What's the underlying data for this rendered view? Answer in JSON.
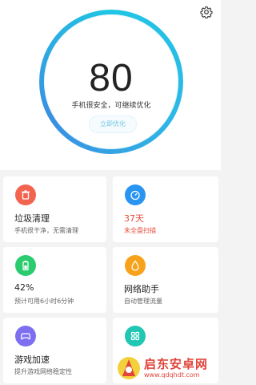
{
  "header": {
    "score": "80",
    "status_text": "手机很安全，可继续优化",
    "optimize_label": "立即优化"
  },
  "cards": [
    {
      "title": "垃圾清理",
      "subtitle": "手机很干净，无需清理",
      "icon": "trash-icon",
      "color": "#f26350"
    },
    {
      "title": "37天",
      "subtitle": "未全盘扫描",
      "icon": "stopwatch-icon",
      "color": "#2a95f0",
      "alert": true
    },
    {
      "title": "42%",
      "subtitle": "预计可用6小时6分钟",
      "icon": "battery-icon",
      "color": "#2bcb6f"
    },
    {
      "title": "网络助手",
      "subtitle": "自动管理流量",
      "icon": "droplet-icon",
      "color": "#f7a21b"
    },
    {
      "title": "游戏加速",
      "subtitle": "提升游戏网络稳定性",
      "icon": "gamepad-icon",
      "color": "#7d6ff0"
    },
    {
      "title": "",
      "subtitle": "",
      "icon": "grid-apps-icon",
      "color": "#21c7b2"
    }
  ],
  "watermark": {
    "name": "启东安卓网",
    "url": "www.qdqhdt.com"
  }
}
